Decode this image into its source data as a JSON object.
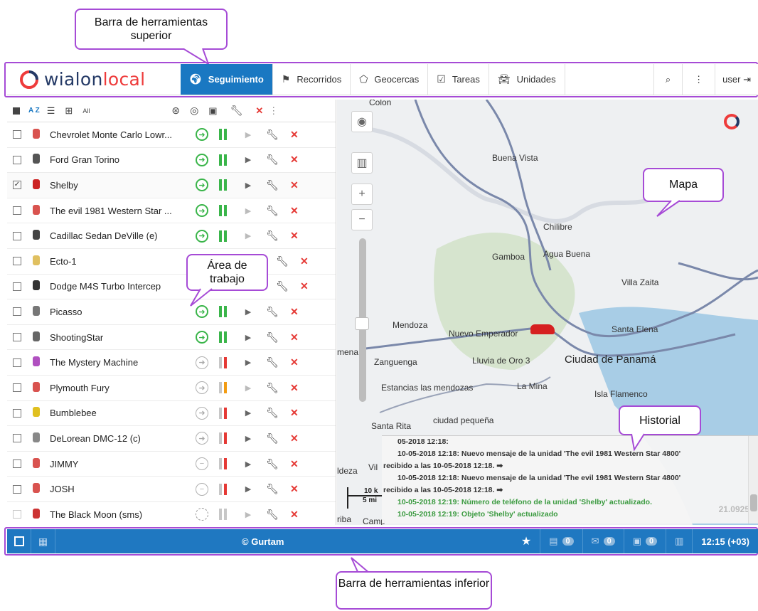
{
  "callouts": {
    "top": "Barra de herramientas superior",
    "map": "Mapa",
    "work": "Área de trabajo",
    "history": "Historial",
    "bottom": "Barra de herramientas inferior"
  },
  "logo": {
    "left": "wialon",
    "right": "local"
  },
  "nav": {
    "tabs": [
      {
        "label": "Seguimiento",
        "icon": "globe-icon"
      },
      {
        "label": "Recorridos",
        "icon": "checkered-flag-icon"
      },
      {
        "label": "Geocercas",
        "icon": "geofence-icon"
      },
      {
        "label": "Tareas",
        "icon": "checklist-icon"
      },
      {
        "label": "Unidades",
        "icon": "car-icon"
      }
    ],
    "user": "user"
  },
  "panel": {
    "header_sort": "A Z",
    "header_all": "All",
    "units": [
      {
        "name": "Chevrolet Monte Carlo Lowr...",
        "checked": false,
        "motion": "green",
        "conn": "green",
        "play": "dim",
        "icon_color": "#d9534f"
      },
      {
        "name": "Ford Gran Torino",
        "checked": false,
        "motion": "green",
        "conn": "green",
        "play": "on",
        "icon_color": "#555555"
      },
      {
        "name": "Shelby",
        "checked": true,
        "motion": "green",
        "conn": "green",
        "play": "on",
        "icon_color": "#cc2222"
      },
      {
        "name": "The evil 1981 Western Star ...",
        "checked": false,
        "motion": "green",
        "conn": "green",
        "play": "dim",
        "icon_color": "#d9534f"
      },
      {
        "name": "Cadillac Sedan DeVille (e)",
        "checked": false,
        "motion": "green",
        "conn": "green",
        "play": "dim",
        "icon_color": "#444444"
      },
      {
        "name": "Ecto-1",
        "checked": false,
        "motion": "none",
        "conn": "none",
        "play": "none",
        "icon_color": "#e0c060"
      },
      {
        "name": "Dodge M4S Turbo Intercep",
        "checked": false,
        "motion": "none",
        "conn": "none",
        "play": "none",
        "icon_color": "#333333"
      },
      {
        "name": "Picasso",
        "checked": false,
        "motion": "green",
        "conn": "green",
        "play": "on",
        "icon_color": "#777777"
      },
      {
        "name": "ShootingStar",
        "checked": false,
        "motion": "green",
        "conn": "green",
        "play": "on",
        "icon_color": "#666666"
      },
      {
        "name": "The Mystery Machine",
        "checked": false,
        "motion": "gray",
        "conn": "red",
        "play": "on",
        "icon_color": "#b050c0"
      },
      {
        "name": "Plymouth Fury",
        "checked": false,
        "motion": "gray",
        "conn": "orange",
        "play": "dim",
        "icon_color": "#d9534f"
      },
      {
        "name": "Bumblebee",
        "checked": false,
        "motion": "gray",
        "conn": "red",
        "play": "on",
        "icon_color": "#e0c020"
      },
      {
        "name": "DeLorean DMC-12 (c)",
        "checked": false,
        "motion": "gray",
        "conn": "red",
        "play": "on",
        "icon_color": "#888888"
      },
      {
        "name": "JIMMY",
        "checked": false,
        "motion": "minus",
        "conn": "red",
        "play": "on",
        "icon_color": "#d9534f"
      },
      {
        "name": "JOSH",
        "checked": false,
        "motion": "minus",
        "conn": "red",
        "play": "on",
        "icon_color": "#d9534f"
      },
      {
        "name": "The Black Moon (sms)",
        "checked": false,
        "motion": "dash",
        "conn": "gray",
        "play": "dim",
        "icon_color": "#cc3333"
      }
    ]
  },
  "map": {
    "labels": [
      "Colon",
      "Buena Vista",
      "Chilibre",
      "Gamboa",
      "Agua Buena",
      "Villa Zaita",
      "Mendoza",
      "Nuevo Emperador",
      "Santa Elena",
      "mena",
      "Zanguenga",
      "Lluvia de Oro 3",
      "Ciudad de Panamá",
      "Estancias las mendozas",
      "La Mina",
      "Isla Flamenco",
      "Santa Rita",
      "ciudad pequeña",
      "ldeza",
      "Vil",
      "riba",
      "Camp"
    ],
    "scale_top": "10 k",
    "scale_bottom": "5 mi",
    "coord": "21.0925"
  },
  "history": {
    "lines": [
      {
        "text": "05-2018 12:18:",
        "style": "n"
      },
      {
        "text": "10-05-2018 12:18: Nuevo mensaje de la unidad 'The evil 1981 Western Star 4800'",
        "style": "n"
      },
      {
        "text": "recibido a las 10-05-2018 12:18. ➡",
        "style": "w"
      },
      {
        "text": "10-05-2018 12:18: Nuevo mensaje de la unidad 'The evil 1981 Western Star 4800'",
        "style": "n"
      },
      {
        "text": "recibido a las 10-05-2018 12:18. ➡",
        "style": "w"
      },
      {
        "text": "10-05-2018 12:19: Número de teléfono de la unidad 'Shelby' actualizado.",
        "style": "g"
      },
      {
        "text": "10-05-2018 12:19: Objeto 'Shelby' actualizado",
        "style": "g"
      }
    ]
  },
  "bottom": {
    "copyright": "© Gurtam",
    "badge_1": "0",
    "badge_2": "0",
    "badge_3": "0",
    "time": "12:15 (+03)"
  },
  "colors": {
    "brand_blue": "#1a78c2",
    "callout": "#a64bd6",
    "ok": "#3ab54a",
    "alert": "#e53935"
  }
}
